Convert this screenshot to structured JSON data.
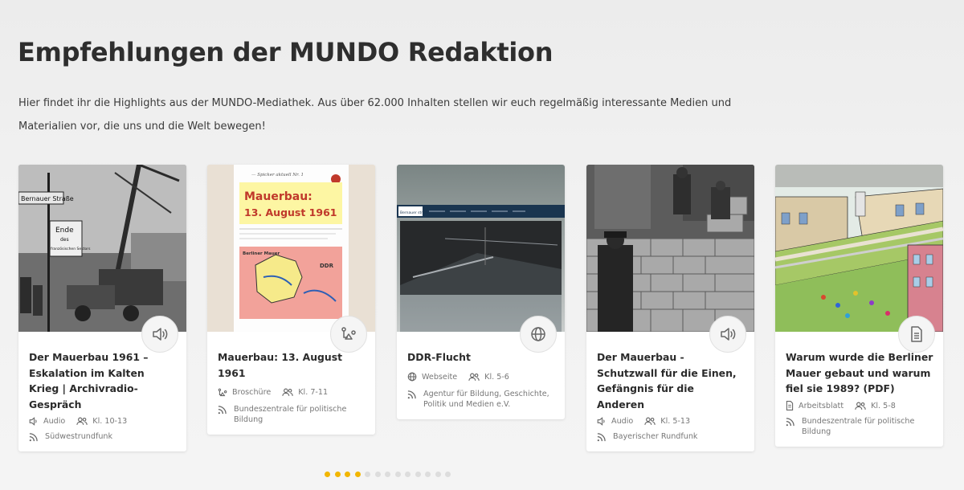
{
  "heading": "Empfehlungen der MUNDO Redaktion",
  "intro": "Hier findet ihr die Highlights aus der MUNDO-Mediathek. Aus über 62.000 Inhalten stellen wir euch regelmäßig interessante Medien und Materialien vor, die uns und die Welt bewegen!",
  "cards": [
    {
      "title": "Der Mauerbau 1961 – Eskalation im Kalten Krieg | Archivradio-Gespräch",
      "type": "Audio",
      "type_icon": "speaker-icon",
      "grade": "Kl. 10-13",
      "source": "Südwestrundfunk",
      "thumb_labels": {
        "street": "Bernauer Straße",
        "sign1": "Ende",
        "sign2": "des",
        "sign3": "französischen Sektors"
      }
    },
    {
      "title": "Mauerbau: 13. August 1961",
      "type": "Broschüre",
      "type_icon": "brochure-icon",
      "grade": "Kl. 7-11",
      "source": "Bundeszentrale für politische Bildung",
      "thumb_labels": {
        "top": "— Spicker aktuell Nr. 1",
        "headline1": "Mauerbau:",
        "headline2": "13. August 1961",
        "map_left": "Berliner Mauer",
        "map_right": "DDR"
      }
    },
    {
      "title": "DDR-Flucht",
      "type": "Webseite",
      "type_icon": "globe-icon",
      "grade": "Kl. 5-6",
      "source": "Agentur für Bildung, Geschichte, Politik und Medien e.V.",
      "thumb_labels": {
        "logo": "Bernauer straße"
      }
    },
    {
      "title": "Der Mauerbau - Schutzwall für die Einen, Gefängnis für die Anderen",
      "type": "Audio",
      "type_icon": "speaker-icon",
      "grade": "Kl. 5-13",
      "source": "Bayerischer Rundfunk"
    },
    {
      "title": "Warum wurde die Berliner Mauer gebaut und warum fiel sie 1989? (PDF)",
      "type": "Arbeitsblatt",
      "type_icon": "worksheet-icon",
      "grade": "Kl. 5-8",
      "source": "Bundeszentrale für politische Bildung"
    }
  ],
  "pagination": {
    "total": 13,
    "active": [
      0,
      1,
      2,
      3
    ]
  },
  "colors": {
    "accent": "#f2b600",
    "dot_inactive": "#dddddd"
  }
}
